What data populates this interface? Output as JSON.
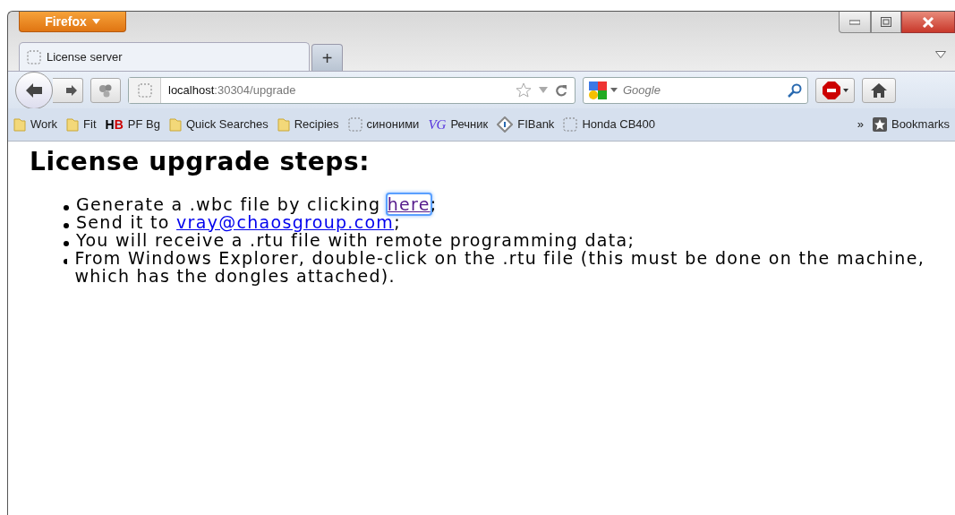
{
  "browser": {
    "menu_button": "Firefox",
    "tabs": [
      {
        "title": "License server",
        "selected": true
      }
    ],
    "new_tab": "+",
    "address": {
      "host": "localhost",
      "rest": ":30304/upgrade"
    },
    "search": {
      "placeholder": "Google"
    },
    "bookmarks": [
      {
        "kind": "folder",
        "label": "Work"
      },
      {
        "kind": "folder",
        "label": "Fit"
      },
      {
        "kind": "textlogo",
        "logo": "HB",
        "label": "PF Bg"
      },
      {
        "kind": "folder",
        "label": "Quick Searches"
      },
      {
        "kind": "folder",
        "label": "Recipies"
      },
      {
        "kind": "page",
        "label": "синоними"
      },
      {
        "kind": "italiclogo",
        "logo": "VG",
        "label": "Речник"
      },
      {
        "kind": "diamond",
        "label": "FIBank"
      },
      {
        "kind": "page",
        "label": "Honda CB400"
      }
    ],
    "overflow": "»",
    "bookmarks_menu": "Bookmarks"
  },
  "page": {
    "heading": "License upgrade steps:",
    "steps": [
      {
        "before": "Generate a .wbc file by clicking ",
        "link": {
          "text": "here",
          "visited": true,
          "focused": true
        },
        "after": ";"
      },
      {
        "before": "Send it to ",
        "link": {
          "text": "vray@chaosgroup.com",
          "visited": false,
          "focused": false
        },
        "after": ";"
      },
      {
        "before": "You will receive a .rtu file with remote programming data;"
      },
      {
        "before": "From Windows Explorer, double-click on the .rtu file (this must be done on the machine, which has the dongles attached)."
      }
    ]
  }
}
